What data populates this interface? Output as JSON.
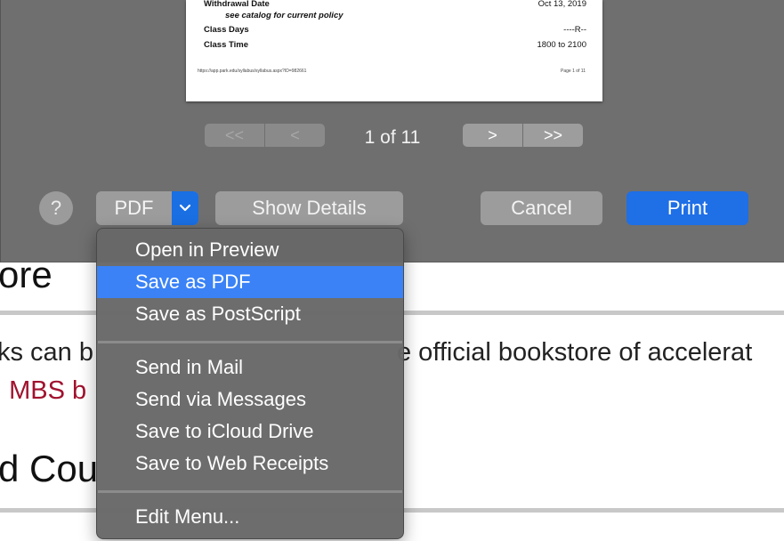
{
  "background": {
    "heading_top": "ore",
    "text_line1_left": "ks can b",
    "text_line1_right": "e official bookstore of accelerat",
    "link_text": ". MBS b",
    "heading_bottom": "d Cou",
    "text_bottom_left": "",
    "text_bottom_right": ""
  },
  "preview": {
    "rows": [
      {
        "label": "Withdrawal Date",
        "value": "Oct 13, 2019"
      },
      {
        "label": "Class Days",
        "value": "----R--"
      },
      {
        "label": "Class Time",
        "value": "1800 to 2100"
      }
    ],
    "italic_note": "see catalog for current policy",
    "footer_url": "https://app.park.edu/syllabus/syllabus.aspx?ID=982661",
    "footer_page": "Page 1 of 11"
  },
  "navigation": {
    "first": "<<",
    "prev": "<",
    "next": ">",
    "last": ">>",
    "page_indicator": "1 of 11"
  },
  "buttons": {
    "help": "?",
    "pdf": "PDF",
    "show_details": "Show Details",
    "cancel": "Cancel",
    "print": "Print"
  },
  "pdf_menu": {
    "group1": [
      "Open in Preview",
      "Save as PDF",
      "Save as PostScript"
    ],
    "group2": [
      "Send in Mail",
      "Send via Messages",
      "Save to iCloud Drive",
      "Save to Web Receipts"
    ],
    "group3": [
      "Edit Menu..."
    ],
    "highlighted": "Save as PDF"
  },
  "colors": {
    "accent": "#1f6fe6",
    "highlight": "#3a82f6",
    "link": "#a0122e"
  }
}
